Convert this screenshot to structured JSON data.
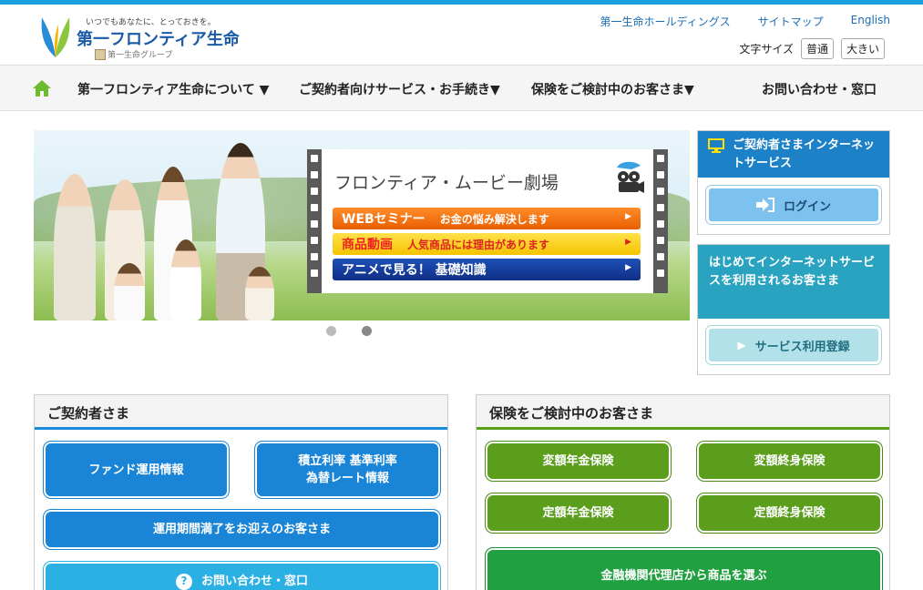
{
  "header": {
    "tagline": "いつでもあなたに、とっておきを。",
    "company": "第一フロンティア生命",
    "group": "第一生命グループ",
    "util_links": [
      "第一生命ホールディングス",
      "サイトマップ",
      "English"
    ],
    "font_size_label": "文字サイズ",
    "font_normal": "普通",
    "font_large": "大きい"
  },
  "nav": {
    "items": [
      "第一フロンティア生命について ▼",
      "ご契約者向けサービス・お手続き▼",
      "保険をご検討中のお客さま▼",
      "お問い合わせ・窓口"
    ]
  },
  "hero": {
    "title": "フロンティア・ムービー劇場",
    "buttons": [
      {
        "label": "WEBセミナー",
        "text": "お金の悩み解決します"
      },
      {
        "label": "商品動画",
        "text": "人気商品には理由があります"
      },
      {
        "label": "アニメで見る！ 基礎知識",
        "text": ""
      }
    ],
    "slide_count": 2,
    "active_slide": 2
  },
  "side": {
    "internet_title": "ご契約者さまインターネットサービス",
    "login": "ログイン",
    "first_title": "はじめてインターネットサービスを利用されるお客さま",
    "register": "サービス利用登録"
  },
  "contract_panel": {
    "title": "ご契約者さま",
    "fund": "ファンド運用情報",
    "rates_line1": "積立利率 基準利率",
    "rates_line2": "為替レート情報",
    "maturity": "運用期間満了をお迎えのお客さま",
    "contact": "お問い合わせ・窓口"
  },
  "prospect_panel": {
    "title": "保険をご検討中のお客さま",
    "variable_annuity": "変額年金保険",
    "variable_whole": "変額終身保険",
    "fixed_annuity": "定額年金保険",
    "fixed_whole": "定額終身保険",
    "agency": "金融機関代理店から商品を選ぶ"
  }
}
